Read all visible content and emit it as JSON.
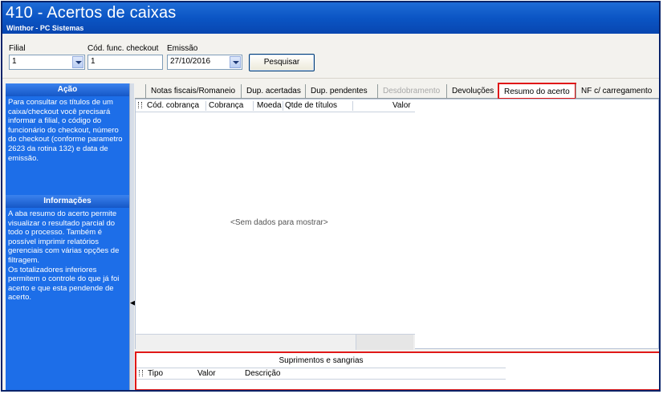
{
  "window": {
    "title": "410 - Acertos de caixas",
    "subtitle": "Winthor - PC Sistemas"
  },
  "filters": {
    "filial_label": "Filial",
    "filial_value": "1",
    "func_label": "Cód. func. checkout",
    "func_value": "1",
    "emissao_label": "Emissão",
    "emissao_value": "27/10/2016",
    "search_button": "Pesquisar"
  },
  "sidebar": {
    "acao_title": "Ação",
    "acao_text": "Para consultar os títulos de um caixa/checkout você precisará informar a filial, o código do funcionário do checkout, número do checkout (conforme parametro 2623 da rotina 132) e data de emissão.",
    "info_title": "Informações",
    "info_text": "A aba resumo do acerto permite visualizar o resultado parcial do todo o processo. Também é possível imprimir relatórios gerenciais com várias opções de filtragem.\nOs totalizadores inferiores permitem o controle do que já foi acerto e que esta pendende de acerto."
  },
  "tabs": [
    {
      "label": "Notas fiscais/Romaneio",
      "state": "normal"
    },
    {
      "label": "Dup. acertadas",
      "state": "normal"
    },
    {
      "label": "Dup. pendentes",
      "state": "normal"
    },
    {
      "label": "Desdobramento",
      "state": "disabled"
    },
    {
      "label": "Devoluções",
      "state": "normal"
    },
    {
      "label": "Resumo do acerto",
      "state": "active"
    },
    {
      "label": "NF c/ carregamento",
      "state": "normal"
    }
  ],
  "grid": {
    "columns": [
      "Cód. cobrança",
      "Cobrança",
      "Moeda",
      "Qtde de títulos",
      "Valor"
    ],
    "empty_message": "<Sem dados para mostrar>"
  },
  "suprimentos": {
    "title": "Suprimentos e sangrias",
    "columns": [
      "Tipo",
      "Valor",
      "Descrição"
    ]
  },
  "colors": {
    "title_bar": "#0b55c4",
    "sidebar": "#1d6ee8",
    "highlight": "#e01818"
  }
}
